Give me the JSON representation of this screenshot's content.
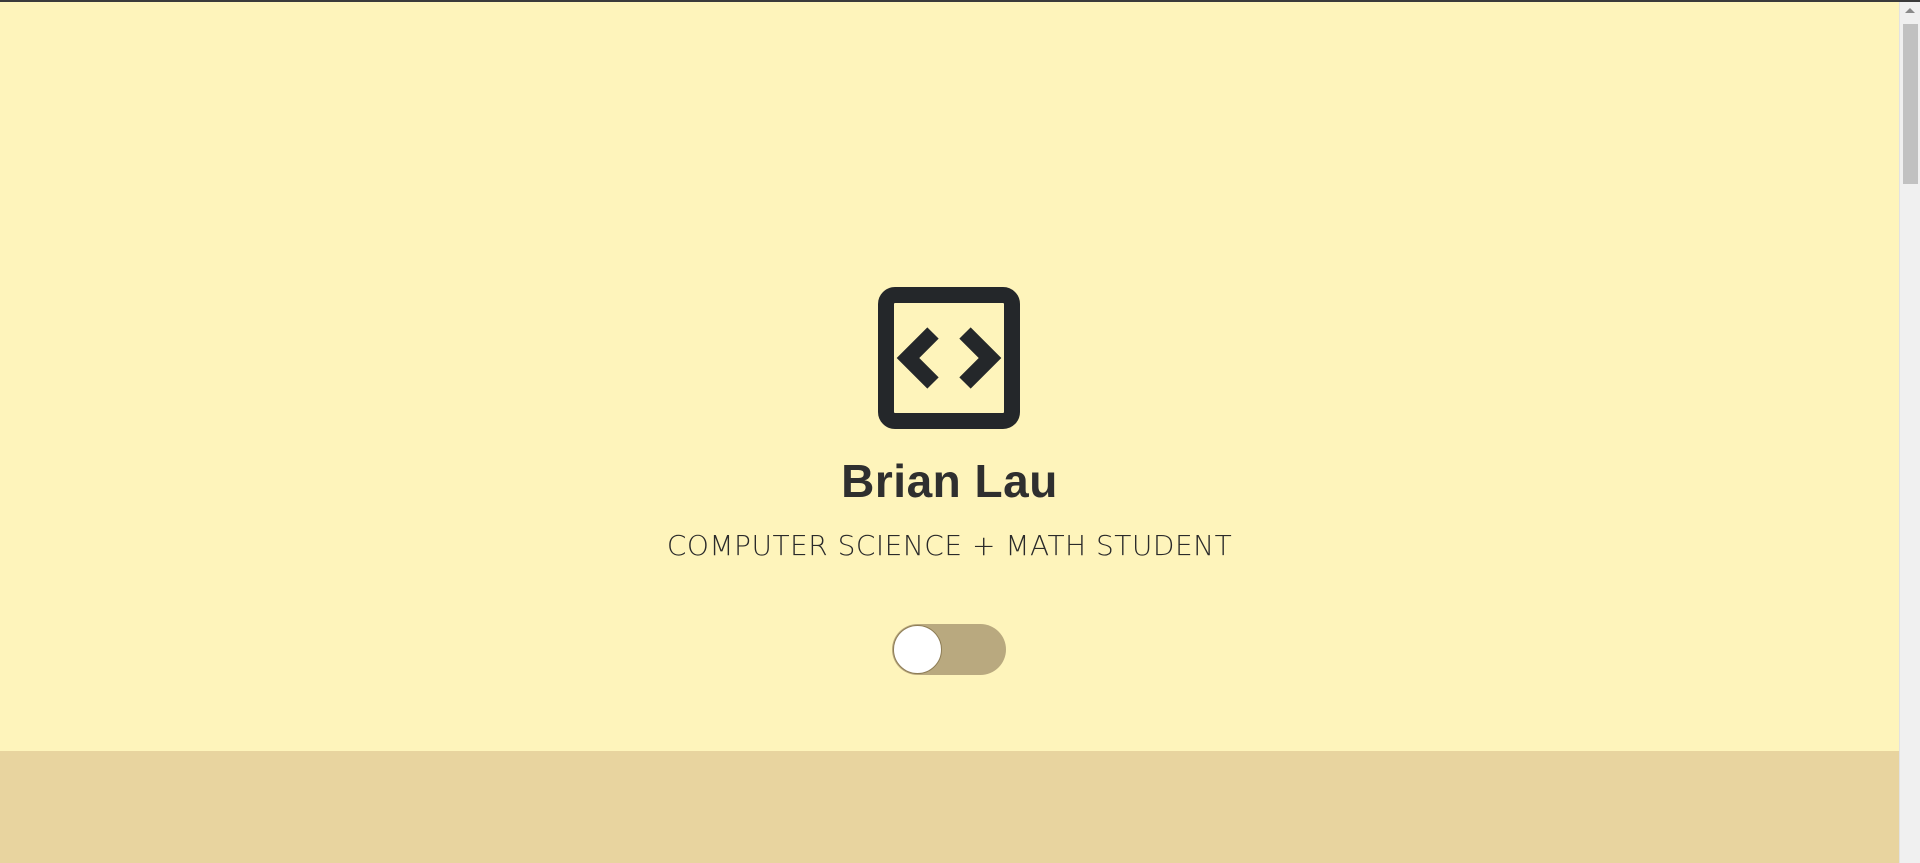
{
  "hero": {
    "logo_icon": "code-brackets-icon",
    "name": "Brian Lau",
    "subtitle": "COMPUTER SCIENCE + MATH STUDENT",
    "theme_toggle": {
      "state": "off"
    }
  },
  "colors": {
    "hero_background": "#fef4bb",
    "next_section_background": "#e8d49f",
    "text_primary": "#2f2f2f",
    "icon_color": "#24272a",
    "toggle_track": "#b9a97f",
    "toggle_knob": "#ffffff"
  },
  "scrollbar": {
    "up_arrow_icon": "chevron-up-icon"
  }
}
